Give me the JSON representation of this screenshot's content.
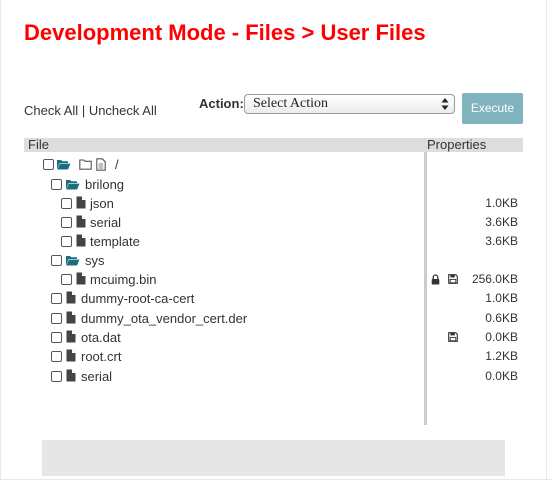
{
  "page": {
    "title": "Development Mode - Files > User Files"
  },
  "toolbar": {
    "check_all": "Check All",
    "separator": " | ",
    "uncheck_all": "Uncheck All",
    "action_label": "Action:",
    "action_select": "Select Action",
    "execute": "Execute"
  },
  "table": {
    "col_file": "File",
    "col_properties": "Properties"
  },
  "tree": {
    "root": {
      "name": "/"
    },
    "items": [
      {
        "name": "brilong",
        "type": "folder"
      },
      {
        "name": "json",
        "type": "file",
        "size": "1.0KB"
      },
      {
        "name": "serial",
        "type": "file",
        "size": "3.6KB"
      },
      {
        "name": "template",
        "type": "file",
        "size": "3.6KB"
      },
      {
        "name": "sys",
        "type": "folder"
      },
      {
        "name": "mcuimg.bin",
        "type": "file",
        "size": "256.0KB",
        "icons": [
          "lock-icon",
          "save-icon"
        ]
      },
      {
        "name": "dummy-root-ca-cert",
        "type": "file",
        "size": "1.0KB"
      },
      {
        "name": "dummy_ota_vendor_cert.der",
        "type": "file",
        "size": "0.6KB"
      },
      {
        "name": "ota.dat",
        "type": "file",
        "size": "0.0KB",
        "icons": [
          "save-icon"
        ]
      },
      {
        "name": "root.crt",
        "type": "file",
        "size": "1.2KB"
      },
      {
        "name": "serial",
        "type": "file",
        "size": "0.0KB"
      }
    ]
  },
  "colors": {
    "title": "#ff0000",
    "folder": "#1a6e80",
    "button": "#7fb3bd",
    "header_bg": "#dddddd"
  }
}
